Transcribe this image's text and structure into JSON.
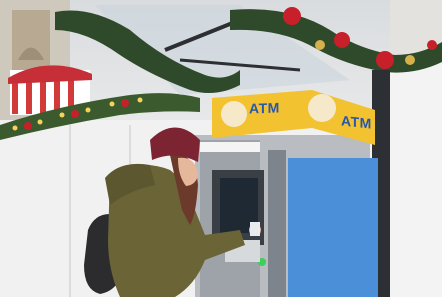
{
  "photo": {
    "atm_sign_left": "ATM",
    "atm_sign_right": "ATM",
    "colors": {
      "atm_yellow": "#f2c230",
      "atm_blue": "#4b8fd8",
      "atm_grey": "#b9bdc2",
      "jacket_olive": "#6b6436",
      "beanie_burgundy": "#7d2432",
      "garland_green": "#2f4a2a",
      "ornament_red": "#c8202a"
    }
  }
}
